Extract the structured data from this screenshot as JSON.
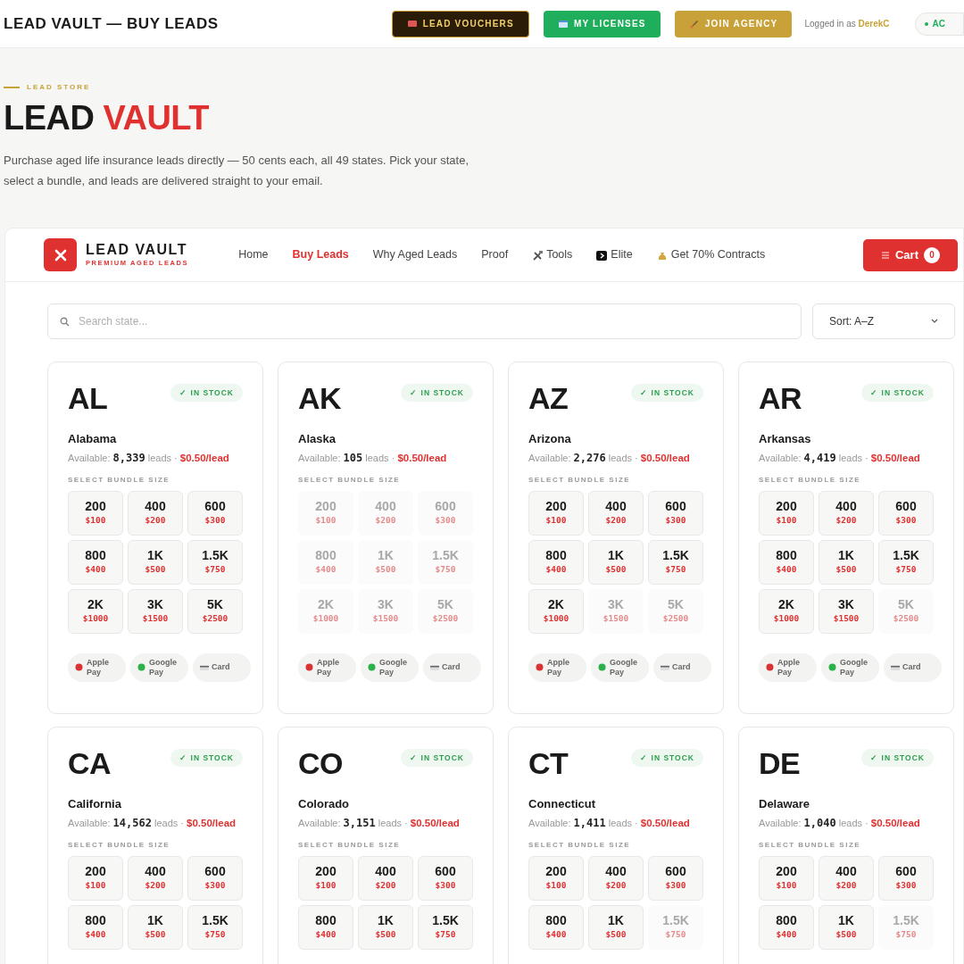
{
  "top_bar": {
    "title": "LEAD VAULT — BUY LEADS",
    "buttons": [
      {
        "kind": "vouchers",
        "label": "LEAD VOUCHERS"
      },
      {
        "kind": "licenses",
        "label": "MY LICENSES"
      },
      {
        "kind": "agency",
        "label": "JOIN AGENCY"
      }
    ],
    "login_prefix": "Logged in as",
    "user": "DerekC",
    "status_pill": "AC"
  },
  "hero": {
    "eyebrow": "LEAD STORE",
    "title": "LEAD",
    "title_highlight": "VAULT",
    "description": "Purchase aged life insurance leads directly — 50 cents each, all 49 states. Pick your state, select a bundle, and leads are delivered straight to your email."
  },
  "site": {
    "brand": "LEAD VAULT",
    "tagline": "PREMIUM AGED LEADS",
    "nav": [
      {
        "label": "Home",
        "kind": "text",
        "selected": false
      },
      {
        "label": "Buy Leads",
        "kind": "text",
        "selected": true
      },
      {
        "label": "Why Aged Leads",
        "kind": "text",
        "selected": false
      },
      {
        "label": "Proof",
        "kind": "text",
        "selected": false
      },
      {
        "label": "Tools",
        "kind": "tools",
        "selected": false
      },
      {
        "label": "Elite",
        "kind": "elite",
        "selected": false
      },
      {
        "label": "Get 70% Contracts",
        "kind": "money",
        "selected": false
      }
    ],
    "cart": {
      "label": "Cart",
      "count": "0"
    },
    "search": {
      "placeholder": "Search state..."
    },
    "sort": "Sort: A–Z"
  },
  "states": [
    {
      "code": "AL",
      "name": "Alabama",
      "badge": "✓ IN STOCK",
      "available_label": "Available:",
      "count": "8,339",
      "unit": "leads ·",
      "price": "$0.50/lead",
      "bundle_label": "SELECT BUNDLE SIZE",
      "bundles": [
        {
          "size": "200",
          "price": "$100",
          "disabled": false
        },
        {
          "size": "400",
          "price": "$200",
          "disabled": false
        },
        {
          "size": "600",
          "price": "$300",
          "disabled": false
        },
        {
          "size": "800",
          "price": "$400",
          "disabled": false
        },
        {
          "size": "1K",
          "price": "$500",
          "disabled": false
        },
        {
          "size": "1.5K",
          "price": "$750",
          "disabled": false
        },
        {
          "size": "2K",
          "price": "$1000",
          "disabled": false
        },
        {
          "size": "3K",
          "price": "$1500",
          "disabled": false
        },
        {
          "size": "5K",
          "price": "$2500",
          "disabled": false
        }
      ],
      "payments": [
        {
          "kind": "apple",
          "label": "Apple Pay"
        },
        {
          "kind": "google",
          "label": "Google Pay"
        },
        {
          "kind": "card",
          "label": "Card"
        }
      ]
    },
    {
      "code": "AK",
      "name": "Alaska",
      "badge": "✓ IN STOCK",
      "available_label": "Available:",
      "count": "105",
      "unit": "leads ·",
      "price": "$0.50/lead",
      "bundle_label": "SELECT BUNDLE SIZE",
      "bundles": [
        {
          "size": "200",
          "price": "$100",
          "disabled": true
        },
        {
          "size": "400",
          "price": "$200",
          "disabled": true
        },
        {
          "size": "600",
          "price": "$300",
          "disabled": true
        },
        {
          "size": "800",
          "price": "$400",
          "disabled": true
        },
        {
          "size": "1K",
          "price": "$500",
          "disabled": true
        },
        {
          "size": "1.5K",
          "price": "$750",
          "disabled": true
        },
        {
          "size": "2K",
          "price": "$1000",
          "disabled": true
        },
        {
          "size": "3K",
          "price": "$1500",
          "disabled": true
        },
        {
          "size": "5K",
          "price": "$2500",
          "disabled": true
        }
      ],
      "payments": [
        {
          "kind": "apple",
          "label": "Apple Pay"
        },
        {
          "kind": "google",
          "label": "Google Pay"
        },
        {
          "kind": "card",
          "label": "Card"
        }
      ]
    },
    {
      "code": "AZ",
      "name": "Arizona",
      "badge": "✓ IN STOCK",
      "available_label": "Available:",
      "count": "2,276",
      "unit": "leads ·",
      "price": "$0.50/lead",
      "bundle_label": "SELECT BUNDLE SIZE",
      "bundles": [
        {
          "size": "200",
          "price": "$100",
          "disabled": false
        },
        {
          "size": "400",
          "price": "$200",
          "disabled": false
        },
        {
          "size": "600",
          "price": "$300",
          "disabled": false
        },
        {
          "size": "800",
          "price": "$400",
          "disabled": false
        },
        {
          "size": "1K",
          "price": "$500",
          "disabled": false
        },
        {
          "size": "1.5K",
          "price": "$750",
          "disabled": false
        },
        {
          "size": "2K",
          "price": "$1000",
          "disabled": false
        },
        {
          "size": "3K",
          "price": "$1500",
          "disabled": true
        },
        {
          "size": "5K",
          "price": "$2500",
          "disabled": true
        }
      ],
      "payments": [
        {
          "kind": "apple",
          "label": "Apple Pay"
        },
        {
          "kind": "google",
          "label": "Google Pay"
        },
        {
          "kind": "card",
          "label": "Card"
        }
      ]
    },
    {
      "code": "AR",
      "name": "Arkansas",
      "badge": "✓ IN STOCK",
      "available_label": "Available:",
      "count": "4,419",
      "unit": "leads ·",
      "price": "$0.50/lead",
      "bundle_label": "SELECT BUNDLE SIZE",
      "bundles": [
        {
          "size": "200",
          "price": "$100",
          "disabled": false
        },
        {
          "size": "400",
          "price": "$200",
          "disabled": false
        },
        {
          "size": "600",
          "price": "$300",
          "disabled": false
        },
        {
          "size": "800",
          "price": "$400",
          "disabled": false
        },
        {
          "size": "1K",
          "price": "$500",
          "disabled": false
        },
        {
          "size": "1.5K",
          "price": "$750",
          "disabled": false
        },
        {
          "size": "2K",
          "price": "$1000",
          "disabled": false
        },
        {
          "size": "3K",
          "price": "$1500",
          "disabled": false
        },
        {
          "size": "5K",
          "price": "$2500",
          "disabled": true
        }
      ],
      "payments": [
        {
          "kind": "apple",
          "label": "Apple Pay"
        },
        {
          "kind": "google",
          "label": "Google Pay"
        },
        {
          "kind": "card",
          "label": "Card"
        }
      ]
    },
    {
      "code": "CA",
      "name": "California",
      "badge": "✓ IN STOCK",
      "available_label": "Available:",
      "count": "14,562",
      "unit": "leads ·",
      "price": "$0.50/lead",
      "bundle_label": "SELECT BUNDLE SIZE",
      "bundles": [
        {
          "size": "200",
          "price": "$100",
          "disabled": false
        },
        {
          "size": "400",
          "price": "$200",
          "disabled": false
        },
        {
          "size": "600",
          "price": "$300",
          "disabled": false
        },
        {
          "size": "800",
          "price": "$400",
          "disabled": false
        },
        {
          "size": "1K",
          "price": "$500",
          "disabled": false
        },
        {
          "size": "1.5K",
          "price": "$750",
          "disabled": false
        }
      ]
    },
    {
      "code": "CO",
      "name": "Colorado",
      "badge": "✓ IN STOCK",
      "available_label": "Available:",
      "count": "3,151",
      "unit": "leads ·",
      "price": "$0.50/lead",
      "bundle_label": "SELECT BUNDLE SIZE",
      "bundles": [
        {
          "size": "200",
          "price": "$100",
          "disabled": false
        },
        {
          "size": "400",
          "price": "$200",
          "disabled": false
        },
        {
          "size": "600",
          "price": "$300",
          "disabled": false
        },
        {
          "size": "800",
          "price": "$400",
          "disabled": false
        },
        {
          "size": "1K",
          "price": "$500",
          "disabled": false
        },
        {
          "size": "1.5K",
          "price": "$750",
          "disabled": false
        }
      ]
    },
    {
      "code": "CT",
      "name": "Connecticut",
      "badge": "✓ IN STOCK",
      "available_label": "Available:",
      "count": "1,411",
      "unit": "leads ·",
      "price": "$0.50/lead",
      "bundle_label": "SELECT BUNDLE SIZE",
      "bundles": [
        {
          "size": "200",
          "price": "$100",
          "disabled": false
        },
        {
          "size": "400",
          "price": "$200",
          "disabled": false
        },
        {
          "size": "600",
          "price": "$300",
          "disabled": false
        },
        {
          "size": "800",
          "price": "$400",
          "disabled": false
        },
        {
          "size": "1K",
          "price": "$500",
          "disabled": false
        },
        {
          "size": "1.5K",
          "price": "$750",
          "disabled": true
        }
      ]
    },
    {
      "code": "DE",
      "name": "Delaware",
      "badge": "✓ IN STOCK",
      "available_label": "Available:",
      "count": "1,040",
      "unit": "leads ·",
      "price": "$0.50/lead",
      "bundle_label": "SELECT BUNDLE SIZE",
      "bundles": [
        {
          "size": "200",
          "price": "$100",
          "disabled": false
        },
        {
          "size": "400",
          "price": "$200",
          "disabled": false
        },
        {
          "size": "600",
          "price": "$300",
          "disabled": false
        },
        {
          "size": "800",
          "price": "$400",
          "disabled": false
        },
        {
          "size": "1K",
          "price": "$500",
          "disabled": false
        },
        {
          "size": "1.5K",
          "price": "$750",
          "disabled": true
        }
      ]
    }
  ]
}
